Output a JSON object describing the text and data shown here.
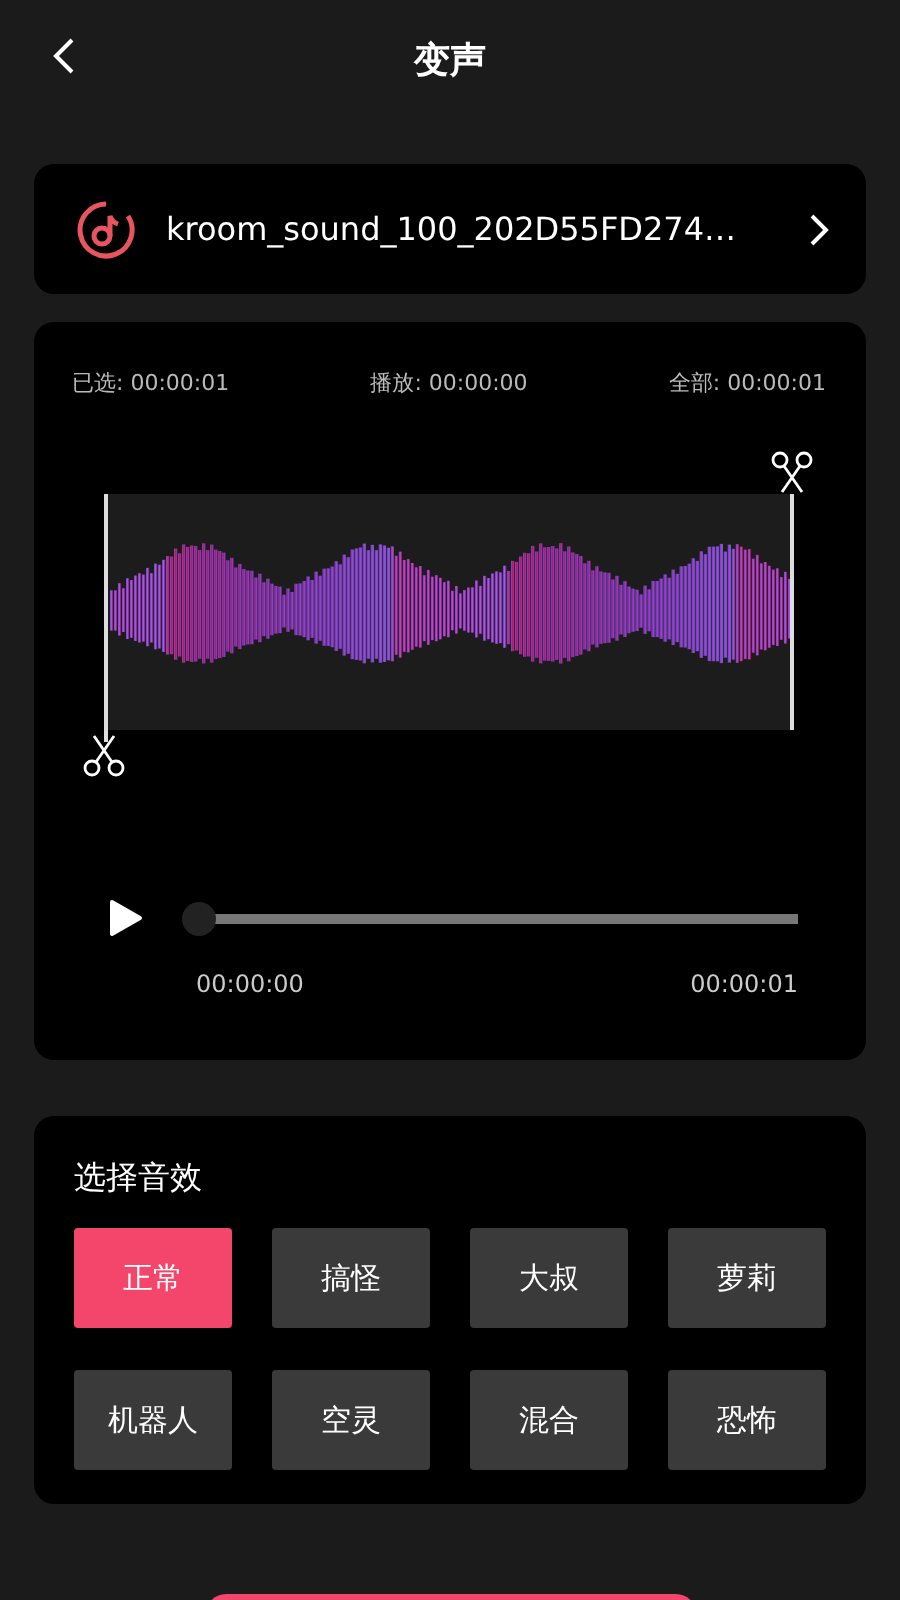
{
  "header": {
    "title": "变声"
  },
  "file": {
    "name": "kroom_sound_100_202D55FD274…"
  },
  "editor": {
    "selected_label": "已选:",
    "selected_time": "00:00:01",
    "play_label": "播放:",
    "play_time": "00:00:00",
    "total_label": "全部:",
    "total_time": "00:00:01",
    "player": {
      "level": 0,
      "current": "00:00:00",
      "duration": "00:00:01"
    }
  },
  "effects": {
    "title": "选择音效",
    "items": [
      {
        "label": "正常",
        "selected": true
      },
      {
        "label": "搞怪",
        "selected": false
      },
      {
        "label": "大叔",
        "selected": false
      },
      {
        "label": "萝莉",
        "selected": false
      },
      {
        "label": "机器人",
        "selected": false
      },
      {
        "label": "空灵",
        "selected": false
      },
      {
        "label": "混合",
        "selected": false
      },
      {
        "label": "恐怖",
        "selected": false
      }
    ]
  }
}
